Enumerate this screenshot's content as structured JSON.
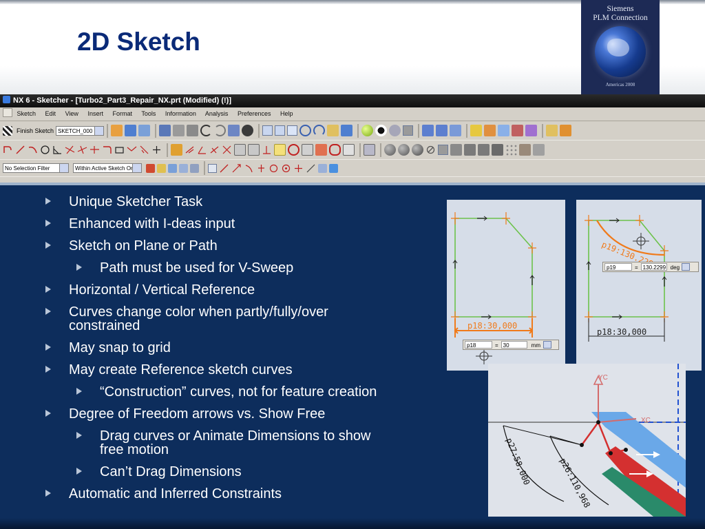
{
  "slide": {
    "title": "2D Sketch",
    "logo": {
      "line1": "Siemens",
      "line2": "PLM Connection",
      "sub": "Americas 2008"
    }
  },
  "nx": {
    "window_title": "NX 6 - Sketcher - [Turbo2_Part3_Repair_NX.prt (Modified)    (!)]",
    "menu": [
      "Sketch",
      "Edit",
      "View",
      "Insert",
      "Format",
      "Tools",
      "Information",
      "Analysis",
      "Preferences",
      "Help"
    ],
    "finish_sketch_label": "Finish Sketch",
    "sketch_name": "SKETCH_000",
    "selection_filter": "No Selection Filter",
    "scope_filter": "Within Active Sketch Or"
  },
  "bullets": [
    {
      "text": "Unique Sketcher Task",
      "level": 1
    },
    {
      "text": "Enhanced with I-deas input",
      "level": 1
    },
    {
      "text": "Sketch on Plane or Path",
      "level": 1
    },
    {
      "text": "Path must be used for V-Sweep",
      "level": 2
    },
    {
      "text": "Horizontal / Vertical Reference",
      "level": 1
    },
    {
      "text": "Curves change color when partly/fully/over",
      "text2": "constrained",
      "level": 1
    },
    {
      "text": "May snap to grid",
      "level": 1
    },
    {
      "text": "May create Reference sketch curves",
      "level": 1
    },
    {
      "text": "“Construction” curves, not for feature creation",
      "level": 2
    },
    {
      "text": "Degree of Freedom arrows vs. Show Free",
      "level": 1
    },
    {
      "text": "Drag curves or Animate Dimensions to show",
      "text2": "free motion",
      "level": 2
    },
    {
      "text": "Can’t Drag Dimensions",
      "level": 2
    },
    {
      "text": "Automatic and Inferred Constraints",
      "level": 1
    }
  ],
  "images": {
    "left": {
      "dim_label": "p18:30,000",
      "field_name": "p18",
      "field_value": "30",
      "unit": "mm"
    },
    "right": {
      "dim_label": "p18:30,000",
      "angle_label": "p19:130.2299",
      "field_name": "p19",
      "field_value": "130.2299",
      "unit": "deg"
    },
    "bottom": {
      "yc": "YC",
      "xc": "XC",
      "dim1": "p27:58,000",
      "dim2": "p26:110,968"
    }
  },
  "colors": {
    "slide_bg": "#0d2d5c",
    "title": "#0a2a78",
    "sketch_green": "#6cc24a",
    "dimension_orange": "#f07a1a"
  }
}
